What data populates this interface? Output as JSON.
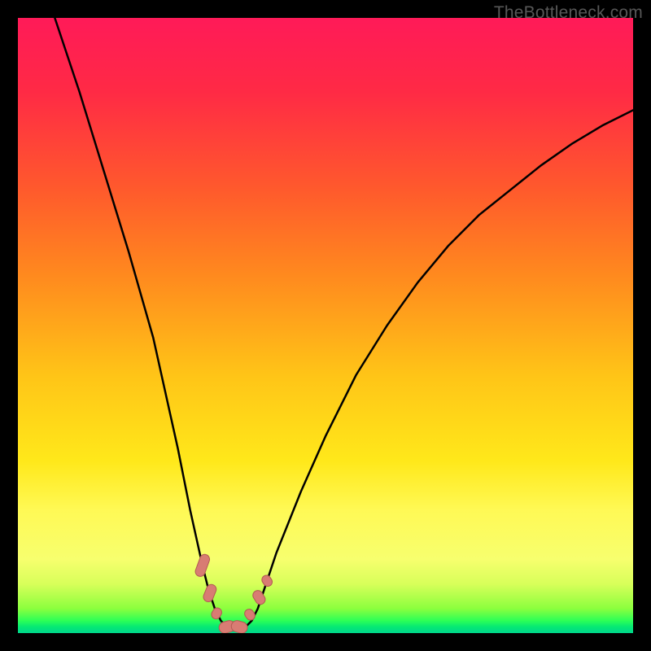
{
  "watermark": "TheBottleneck.com",
  "chart_data": {
    "type": "line",
    "title": "",
    "xlabel": "",
    "ylabel": "",
    "xlim": [
      0,
      100
    ],
    "ylim": [
      0,
      100
    ],
    "grid": false,
    "legend": false,
    "series": [
      {
        "name": "curve",
        "x": [
          6,
          10,
          14,
          18,
          22,
          26,
          28,
          30,
          31,
          32,
          33,
          34,
          35,
          36,
          37,
          38,
          39,
          40,
          42,
          46,
          50,
          55,
          60,
          65,
          70,
          75,
          80,
          85,
          90,
          95,
          100
        ],
        "values": [
          100,
          88,
          75,
          62,
          48,
          30,
          20,
          11,
          7,
          4,
          2,
          1,
          1,
          1,
          1,
          2,
          4,
          7,
          13,
          23,
          32,
          42,
          50,
          57,
          63,
          68,
          72,
          76,
          79.5,
          82.5,
          85
        ]
      }
    ],
    "markers": {
      "note": "pink pill-shaped markers near the trough and on both flanks",
      "color": "#d87c73",
      "stroke": "#b15a52",
      "points": [
        {
          "x": 30.0,
          "y": 11,
          "angle": -70,
          "len": 28,
          "r": 6
        },
        {
          "x": 31.2,
          "y": 6.5,
          "angle": -68,
          "len": 22,
          "r": 6
        },
        {
          "x": 32.3,
          "y": 3.2,
          "angle": -60,
          "len": 14,
          "r": 5.5
        },
        {
          "x": 34.0,
          "y": 1.0,
          "angle": -15,
          "len": 20,
          "r": 7
        },
        {
          "x": 36.0,
          "y": 1.0,
          "angle": 15,
          "len": 20,
          "r": 7
        },
        {
          "x": 37.7,
          "y": 3.0,
          "angle": 55,
          "len": 14,
          "r": 5.5
        },
        {
          "x": 39.2,
          "y": 5.8,
          "angle": 58,
          "len": 18,
          "r": 6
        },
        {
          "x": 40.5,
          "y": 8.5,
          "angle": 56,
          "len": 14,
          "r": 5.5
        }
      ]
    },
    "background_gradient": {
      "direction": "vertical",
      "stops": [
        {
          "pos": 0,
          "color": "#ff1a58"
        },
        {
          "pos": 40,
          "color": "#ff8a1e"
        },
        {
          "pos": 75,
          "color": "#ffe81a"
        },
        {
          "pos": 100,
          "color": "#00d68c"
        }
      ]
    }
  }
}
